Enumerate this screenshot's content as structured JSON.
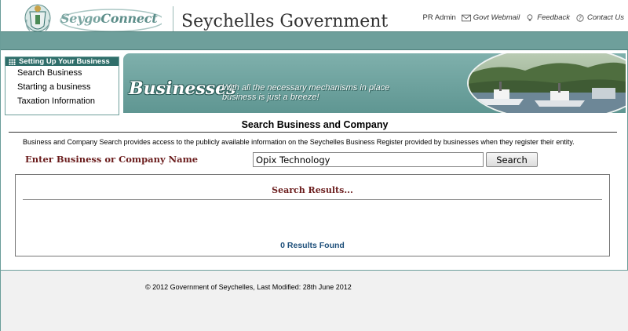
{
  "header": {
    "logo_text_a": "Seygo",
    "logo_text_b": "Connect",
    "site_title": "Seychelles Government",
    "links": [
      {
        "label": "PR Admin",
        "icon": "none"
      },
      {
        "label": "Govt Webmail",
        "icon": "envelope-icon"
      },
      {
        "label": "Feedback",
        "icon": "bulb-icon"
      },
      {
        "label": "Contact Us",
        "icon": "question-icon"
      }
    ]
  },
  "nav": {
    "heading": "Setting Up Your Business",
    "items": [
      "Search Business",
      "Starting a business",
      "Taxation Information"
    ]
  },
  "banner": {
    "word": "Businesses",
    "tagline_1": "With all the necessary mechanisms in place",
    "tagline_2": "business is just a breeze!"
  },
  "search": {
    "title": "Search Business and Company",
    "description": "Business and Company Search provides access to the publicly available information on the Seychelles Business Register provided by businesses when they register their entity.",
    "label": "Enter Business or Company Name",
    "value": "Opix Technology",
    "button": "Search"
  },
  "results": {
    "title": "Search Results...",
    "count_text": "0 Results Found"
  },
  "footer": {
    "copyright": "© 2012 Government of Seychelles, Last Modified: 28th June 2012"
  },
  "colors": {
    "accent_teal": "#6e9f9b",
    "dark_teal": "#2f6e6a",
    "label_maroon": "#6b1d1d",
    "results_blue": "#1d4f7a"
  }
}
